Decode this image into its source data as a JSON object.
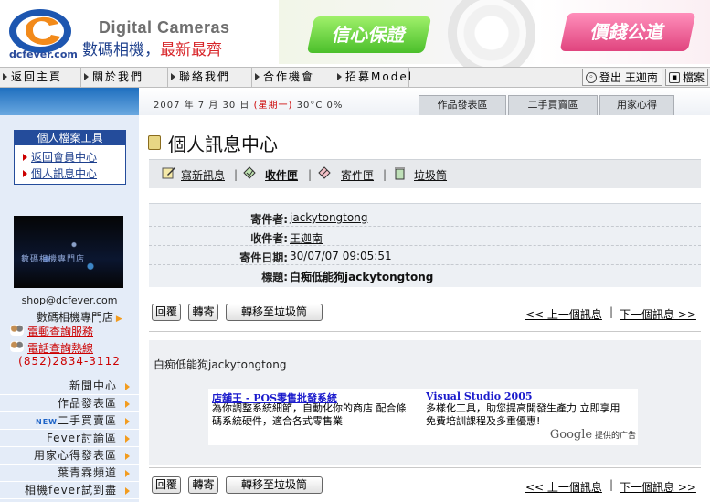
{
  "header": {
    "logo_text": "dcfever.com",
    "brand_en": "Digital Cameras",
    "brand_zh_1": "數碼相機，",
    "brand_zh_2": "最新最齊",
    "banner_left": "信心保證",
    "banner_right": "價錢公道"
  },
  "nav": {
    "items": [
      "返回主頁",
      "關於我們",
      "聯絡我們",
      "合作機會",
      "招募Model"
    ],
    "logout": "登出 王迦南",
    "profile": "檔案"
  },
  "subheader": {
    "date": "2007 年 7 月 30 日",
    "weekday": "(星期一)",
    "weather": "30°C 0%",
    "tabs": [
      "作品發表區",
      "二手買賣區",
      "用家心得"
    ]
  },
  "sidebar": {
    "tools_title": "個人檔案工具",
    "tools": [
      "返回會員中心",
      "個人訊息中心"
    ],
    "promo_text": "數碼相機專門店",
    "email": "shop@dcfever.com",
    "store": "數碼相機專門店",
    "service_email": "電郵查詢服務",
    "service_phone": "電話查詢熱線",
    "phone": "(852)2834-3112",
    "menu": [
      "新聞中心",
      "作品發表區",
      "二手買賣區",
      "Fever討論區",
      "用家心得發表區",
      "葉青霖頻道",
      "相機fever試到盡"
    ],
    "new_badge": "NEW"
  },
  "main": {
    "title": "個人訊息中心",
    "toolbar": [
      "寫新訊息",
      "收件匣",
      "寄件匣",
      "垃圾筒"
    ],
    "fields": [
      {
        "label": "寄件者:",
        "value": "jackytongtong"
      },
      {
        "label": "收件者:",
        "value": "王迦南"
      },
      {
        "label": "寄件日期:",
        "value": "30/07/07 09:05:51"
      },
      {
        "label": "標題:",
        "value": "白痴低能狗jackytongtong"
      }
    ],
    "buttons": [
      "回覆",
      "轉寄",
      "轉移至垃圾筒"
    ],
    "prev": "<< 上一個訊息",
    "next": "下一個訊息 >>",
    "body": "白痴低能狗jackytongtong"
  },
  "ad": {
    "left_title": "店舖王 - POS零售批發系統",
    "left_desc": "為你調整系統細節，自動化你的商店 配合條碼系統硬件，適合各式零售業",
    "right_title": "Visual Studio 2005",
    "right_desc": "多樣化工具，助您提高開發生產力 立即享用免費培訓課程及多重優惠!",
    "google": "Google",
    "google_suffix": "提供的广告"
  }
}
